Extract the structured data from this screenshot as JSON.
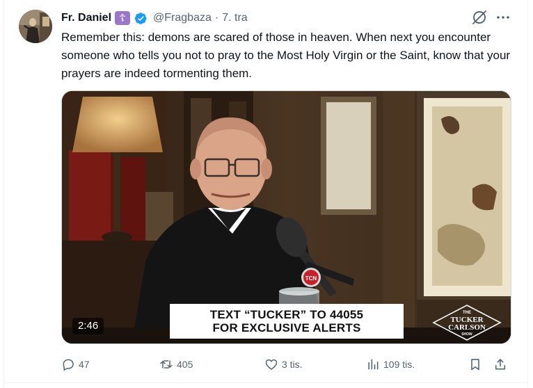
{
  "tweet": {
    "author_name": "Fr. Daniel",
    "badge_glyph": "☦",
    "handle": "@Fragbaza",
    "separator": "·",
    "date": "7. tra",
    "text": "Remember this: demons are scared of those in heaven. When next you encounter someone who tells you not to pray to the Most Holy Virgin or the Saint, know that your prayers are indeed tormenting them."
  },
  "video": {
    "duration": "2:46",
    "lower_third_line1_prefix": "TEXT “TUCKER” TO ",
    "lower_third_line1_number": "44055",
    "lower_third_line2": "FOR EXCLUSIVE ALERTS",
    "logo_top": "THE",
    "logo_line1": "TUCKER",
    "logo_line2": "CARLSON",
    "logo_bottom": "SHOW",
    "mic_logo": "TCN"
  },
  "actions": {
    "replies": "47",
    "reposts": "405",
    "likes": "3 tis.",
    "views": "109 tis."
  },
  "colors": {
    "text_primary": "#0f1419",
    "text_secondary": "#536471",
    "verified_blue": "#1d9bf0",
    "badge_purple": "#9b77c9"
  },
  "icons": [
    "grok-icon",
    "more-icon",
    "verified-icon",
    "reply-icon",
    "repost-icon",
    "like-icon",
    "views-icon",
    "bookmark-icon",
    "share-icon"
  ]
}
